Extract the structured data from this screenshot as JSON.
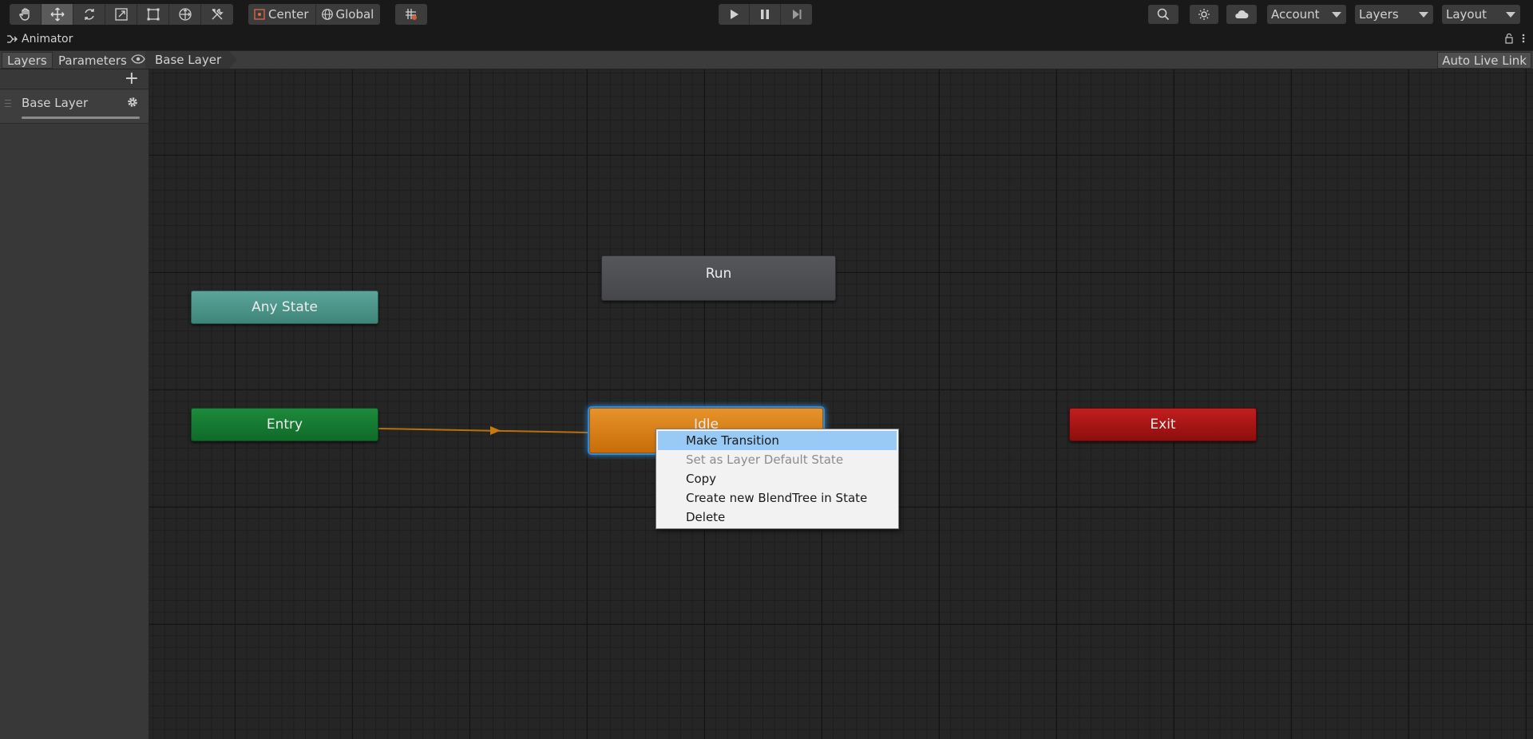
{
  "toolbar": {
    "tools": [
      {
        "name": "hand-tool",
        "icon": "hand-icon"
      },
      {
        "name": "move-tool",
        "icon": "move-icon",
        "active": true
      },
      {
        "name": "rotate-tool",
        "icon": "rotate-icon"
      },
      {
        "name": "scale-tool",
        "icon": "scale-icon"
      },
      {
        "name": "rect-tool",
        "icon": "rect-icon"
      },
      {
        "name": "transform-tool",
        "icon": "transform-icon"
      },
      {
        "name": "custom-tool",
        "icon": "tools-icon"
      }
    ],
    "pivot_label": "Center",
    "space_label": "Global",
    "snap_icon": "grid-snap-icon",
    "play_icon": "play-icon",
    "pause_icon": "pause-icon",
    "step_icon": "step-icon",
    "search_icon": "search-icon",
    "services_icon": "services-icon",
    "cloud_icon": "cloud-icon",
    "account_label": "Account",
    "layers_label": "Layers",
    "layout_label": "Layout"
  },
  "window": {
    "title": "Animator",
    "tabs": {
      "layers": "Layers",
      "parameters": "Parameters"
    },
    "breadcrumb": "Base Layer",
    "auto_live_link": "Auto Live Link"
  },
  "layers_panel": {
    "add_label": "+",
    "layer_name": "Base Layer",
    "weight": 1.0
  },
  "graph": {
    "states": {
      "any_state": "Any State",
      "entry": "Entry",
      "run": "Run",
      "idle": "Idle",
      "exit": "Exit"
    },
    "colors": {
      "any_state": "#4f9a8e",
      "entry": "#15803a",
      "run": "#4e4f52",
      "idle": "#dc8219",
      "exit": "#b01717",
      "selection": "#2f8bd6",
      "transition": "#b8700f"
    }
  },
  "context_menu": {
    "items": [
      {
        "label": "Make Transition",
        "highlighted": true,
        "disabled": false
      },
      {
        "label": "Set as Layer Default State",
        "highlighted": false,
        "disabled": true
      },
      {
        "label": "Copy",
        "highlighted": false,
        "disabled": false
      },
      {
        "label": "Create new BlendTree in State",
        "highlighted": false,
        "disabled": false
      },
      {
        "label": "Delete",
        "highlighted": false,
        "disabled": false
      }
    ]
  }
}
